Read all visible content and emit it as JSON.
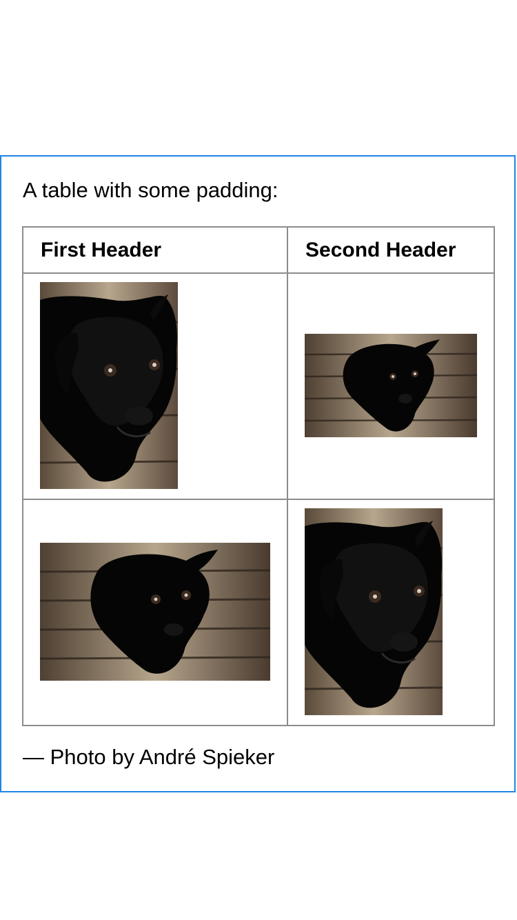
{
  "content": {
    "intro_text": "A table with some padding:",
    "table": {
      "headers": [
        "First Header",
        "Second Header"
      ]
    },
    "photos": [
      "black-puppy-on-wood-floor-portrait",
      "black-puppy-on-wood-floor-landscape",
      "black-puppy-on-wood-floor-landscape",
      "black-puppy-on-wood-floor-portrait"
    ],
    "credit": "— Photo by André Spieker"
  }
}
